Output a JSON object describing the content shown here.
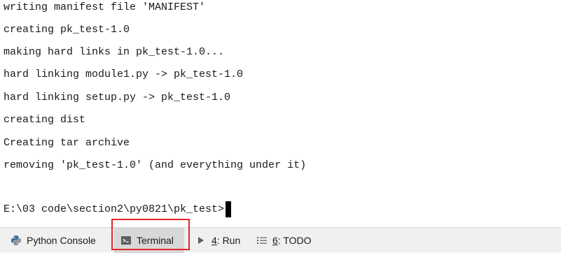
{
  "terminal": {
    "lines": [
      "writing manifest file 'MANIFEST'",
      "creating pk_test-1.0",
      "making hard links in pk_test-1.0...",
      "hard linking module1.py -> pk_test-1.0",
      "hard linking setup.py -> pk_test-1.0",
      "creating dist",
      "Creating tar archive",
      "removing 'pk_test-1.0' (and everything under it)"
    ],
    "prompt": "E:\\03 code\\section2\\py0821\\pk_test>"
  },
  "statusbar": {
    "tabs": {
      "python_console": {
        "label": "Python Console",
        "icon": "python-icon"
      },
      "terminal": {
        "label": "Terminal",
        "icon": "terminal-icon"
      },
      "run": {
        "mnemonic": "4",
        "label": ": Run",
        "icon": "run-icon"
      },
      "todo": {
        "mnemonic": "6",
        "label": ": TODO",
        "icon": "todo-list-icon"
      }
    }
  },
  "colors": {
    "highlight_box": "#e0272b",
    "active_tab": "#d8d8d8",
    "statusbar_bg": "#f0f0f0"
  }
}
